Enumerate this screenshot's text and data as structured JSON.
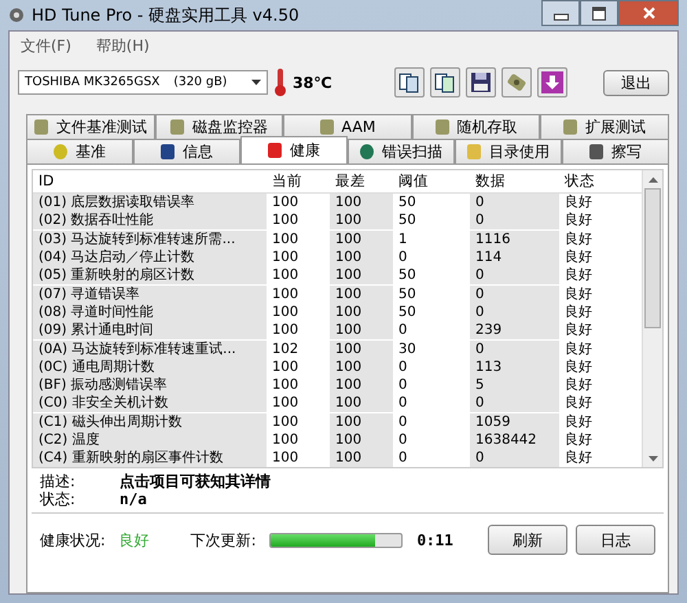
{
  "window": {
    "title": "HD Tune Pro - 硬盘实用工具 v4.50"
  },
  "menu": [
    "文件(F)",
    "帮助(H)"
  ],
  "drive": {
    "name": "TOSHIBA MK3265GSX",
    "size": "(320 gB)"
  },
  "temperature": "38℃",
  "exit_button": "退出",
  "tabs_top": [
    {
      "label": "文件基准测试",
      "selected": false
    },
    {
      "label": "磁盘监控器",
      "selected": false
    },
    {
      "label": "AAM",
      "selected": false
    },
    {
      "label": "随机存取",
      "selected": false
    },
    {
      "label": "扩展测试",
      "selected": false
    }
  ],
  "tabs_bottom": [
    {
      "label": "基准",
      "selected": false
    },
    {
      "label": "信息",
      "selected": false
    },
    {
      "label": "健康",
      "selected": true
    },
    {
      "label": "错误扫描",
      "selected": false
    },
    {
      "label": "目录使用",
      "selected": false
    },
    {
      "label": "擦写",
      "selected": false
    }
  ],
  "table": {
    "columns": [
      "ID",
      "当前",
      "最差",
      "阈值",
      "数据",
      "状态"
    ],
    "rows": [
      [
        "(01) 底层数据读取错误率",
        "100",
        "100",
        "50",
        "0",
        "良好"
      ],
      [
        "(02) 数据吞吐性能",
        "100",
        "100",
        "50",
        "0",
        "良好"
      ],
      [
        "(03) 马达旋转到标准转速所需...",
        "100",
        "100",
        "1",
        "1116",
        "良好"
      ],
      [
        "(04) 马达启动／停止计数",
        "100",
        "100",
        "0",
        "114",
        "良好"
      ],
      [
        "(05) 重新映射的扇区计数",
        "100",
        "100",
        "50",
        "0",
        "良好"
      ],
      [
        "(07) 寻道错误率",
        "100",
        "100",
        "50",
        "0",
        "良好"
      ],
      [
        "(08) 寻道时间性能",
        "100",
        "100",
        "50",
        "0",
        "良好"
      ],
      [
        "(09) 累计通电时间",
        "100",
        "100",
        "0",
        "239",
        "良好"
      ],
      [
        "(0A) 马达旋转到标准转速重试...",
        "102",
        "100",
        "30",
        "0",
        "良好"
      ],
      [
        "(0C) 通电周期计数",
        "100",
        "100",
        "0",
        "113",
        "良好"
      ],
      [
        "(BF) 振动感测错误率",
        "100",
        "100",
        "0",
        "5",
        "良好"
      ],
      [
        "(C0) 非安全关机计数",
        "100",
        "100",
        "0",
        "0",
        "良好"
      ],
      [
        "(C1) 磁头伸出周期计数",
        "100",
        "100",
        "0",
        "1059",
        "良好"
      ],
      [
        "(C2) 温度",
        "100",
        "100",
        "0",
        "1638442",
        "良好"
      ],
      [
        "(C4) 重新映射的扇区事件计数",
        "100",
        "100",
        "0",
        "0",
        "良好"
      ]
    ]
  },
  "description": {
    "label": "描述:",
    "value": "点击项目可获知其详情"
  },
  "status": {
    "label": "状态:",
    "value": "n/a"
  },
  "health": {
    "label": "健康状况:",
    "value": "良好"
  },
  "next_update": {
    "label": "下次更新:",
    "level": 0.8,
    "time": "0:11"
  },
  "buttons": [
    "刷新",
    "日志"
  ]
}
